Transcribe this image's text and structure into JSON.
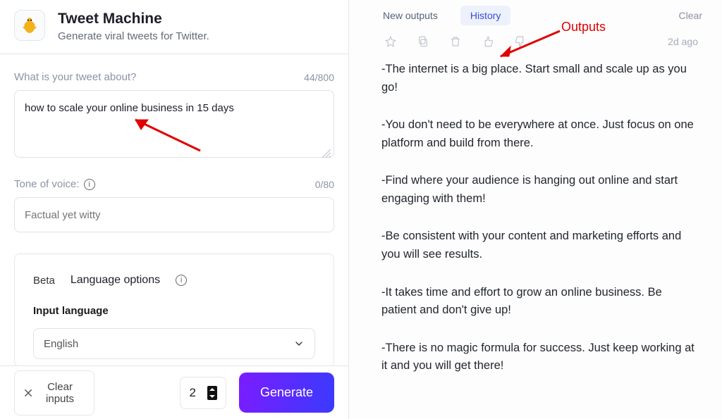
{
  "header": {
    "title": "Tweet Machine",
    "subtitle": "Generate viral tweets for Twitter."
  },
  "form": {
    "topic_label": "What is your tweet about?",
    "topic_value": "how to scale your online business in 15 days",
    "topic_counter": "44/800",
    "tone_label": "Tone of voice:",
    "tone_placeholder": "Factual yet witty",
    "tone_counter": "0/80",
    "lang_beta": "Beta",
    "lang_title": "Language options",
    "input_lang_label": "Input language",
    "input_lang_value": "English",
    "clear_inputs_label": "Clear inputs",
    "quantity_value": "2",
    "generate_label": "Generate"
  },
  "tabs": {
    "new_outputs": "New outputs",
    "history": "History",
    "clear": "Clear"
  },
  "output": {
    "timestamp": "2d ago",
    "paragraphs": [
      "-The internet is a big place. Start small and scale up as you go!",
      "-You don't need to be everywhere at once. Just focus on one platform and build from there.",
      "-Find where your audience is hanging out online and start engaging with them!",
      "-Be consistent with your content and marketing efforts and you will see results.",
      "-It takes time and effort to grow an online business. Be patient and don't give up!",
      "-There is no magic formula for success. Just keep working at it and you will get there!"
    ]
  },
  "annotation": {
    "outputs_label": "Outputs"
  }
}
